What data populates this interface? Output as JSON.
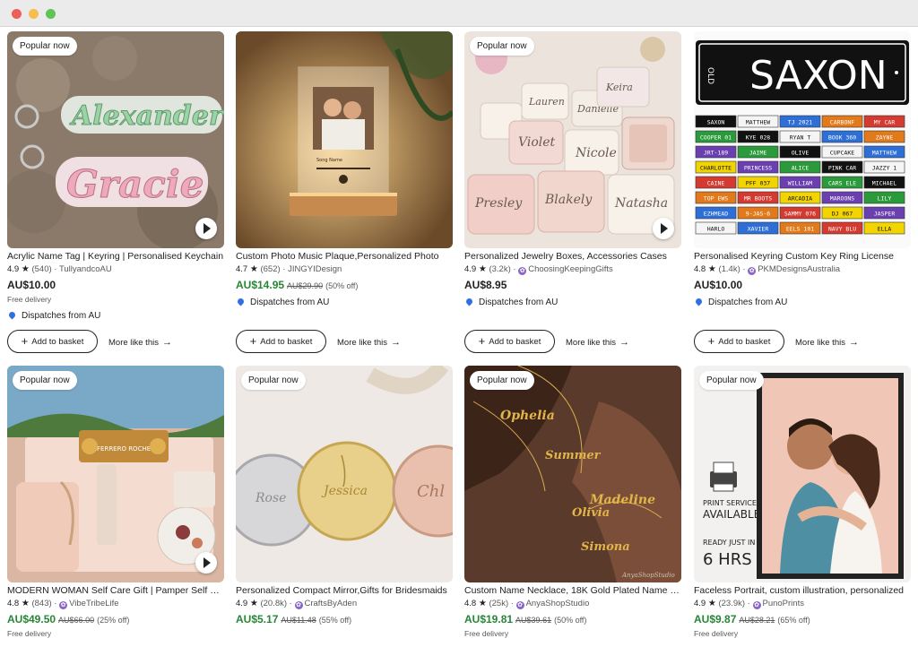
{
  "badge_label": "Popular now",
  "add_label": "Add to basket",
  "more_label": "More like this",
  "row1": [
    {
      "title": "Acrylic Name Tag | Keyring | Personalised Keychain",
      "rating": "4.9",
      "reviews": "(540)",
      "shop": "TullyandcoAU",
      "price": "AU$10.00",
      "orig": "",
      "disc": "",
      "delivery": "Free delivery",
      "dispatch": "Dispatches from AU"
    },
    {
      "title": "Custom Photo Music Plaque,Personalized Photo",
      "rating": "4.7",
      "reviews": "(652)",
      "shop": "JINGYIDesign",
      "price": "AU$14.95",
      "orig": "AU$29.90",
      "disc": "(50% off)",
      "delivery": "",
      "dispatch": "Dispatches from AU"
    },
    {
      "title": "Personalized Jewelry Boxes, Accessories Cases",
      "rating": "4.9",
      "reviews": "(3.2k)",
      "shop": "ChoosingKeepingGifts",
      "price": "AU$8.95",
      "orig": "",
      "disc": "",
      "delivery": "",
      "dispatch": "Dispatches from AU"
    },
    {
      "title": "Personalised Keyring Custom Key Ring License",
      "rating": "4.8",
      "reviews": "(1.4k)",
      "shop": "PKMDesignsAustralia",
      "price": "AU$10.00",
      "orig": "",
      "disc": "",
      "delivery": "",
      "dispatch": "Dispatches from AU"
    }
  ],
  "row2": [
    {
      "title": "MODERN WOMAN Self Care Gift | Pamper Self Care",
      "rating": "4.8",
      "reviews": "(843)",
      "shop": "VibeTribeLife",
      "price": "AU$49.50",
      "orig": "AU$66.00",
      "disc": "(25% off)",
      "delivery": "Free delivery"
    },
    {
      "title": "Personalized Compact Mirror,Gifts for Bridesmaids",
      "rating": "4.9",
      "reviews": "(20.8k)",
      "shop": "CraftsByAden",
      "price": "AU$5.17",
      "orig": "AU$11.48",
      "disc": "(55% off)",
      "delivery": ""
    },
    {
      "title": "Custom Name Necklace, 18K Gold Plated Name Necklace",
      "rating": "4.8",
      "reviews": "(25k)",
      "shop": "AnyaShopStudio",
      "price": "AU$19.81",
      "orig": "AU$39.61",
      "disc": "(50% off)",
      "delivery": "Free delivery"
    },
    {
      "title": "Faceless Portrait, custom illustration, personalized",
      "rating": "4.9",
      "reviews": "(23.9k)",
      "shop": "PunoPrints",
      "price": "AU$9.87",
      "orig": "AU$28.21",
      "disc": "(65% off)",
      "delivery": "Free delivery"
    }
  ],
  "images": {
    "keyring_text_1": "Alexander",
    "keyring_text_2": "Gracie",
    "plaque_song": "Song Name",
    "plate_big": "SAXON",
    "plate_side": "OLD",
    "plates": [
      "SAXON",
      "MATTHEW",
      "TJ 2021",
      "CARBONF",
      "MY CAR",
      "COOPER 01",
      "KYE 028",
      "RYAN T",
      "BOOK 360",
      "ZAYNE",
      "JRT-189",
      "JAIME",
      "OLIVE",
      "CUPCAKE",
      "MATTHEW",
      "CHARLOTTE",
      "PRINCESS",
      "ALICE",
      "PINK CAR",
      "JAZZY 1",
      "CAINE",
      "PFF 037",
      "WILLIAM",
      "CARS ELE",
      "MICHAEL",
      "TOP EWS",
      "MR BOOTS",
      "ARCADIA",
      "MAROONS",
      "LILY",
      "EZHMEAD",
      "9-JAS-6",
      "SAMMY 076",
      "DJ 067",
      "JASPER",
      "HARLO",
      "XAVIER",
      "EELS 101",
      "NAVY BLU",
      "ELLA"
    ],
    "jewelry_names": [
      "Lauren",
      "Danielle",
      "Keira",
      "Violet",
      "Nicole",
      "Presley",
      "Blakely",
      "Natasha"
    ],
    "giftbox_brand": "FERRERO ROCHER",
    "mirror_names": [
      "Rose",
      "Jessica",
      "Chl"
    ],
    "necklace_names": [
      "Ophelia",
      "Summer",
      "Madeline",
      "Olivia",
      "Simona"
    ],
    "necklace_watermark": "AnyaShopStudio",
    "portrait_service": "PRINT SERVICE",
    "portrait_available": "AVAILABLE",
    "portrait_ready": "READY JUST IN",
    "portrait_hours": "6 HRS",
    "colors": {
      "sale_green": "#258635",
      "shop_purple": "#8a65c9",
      "pin_blue": "#2f6fe4"
    }
  }
}
